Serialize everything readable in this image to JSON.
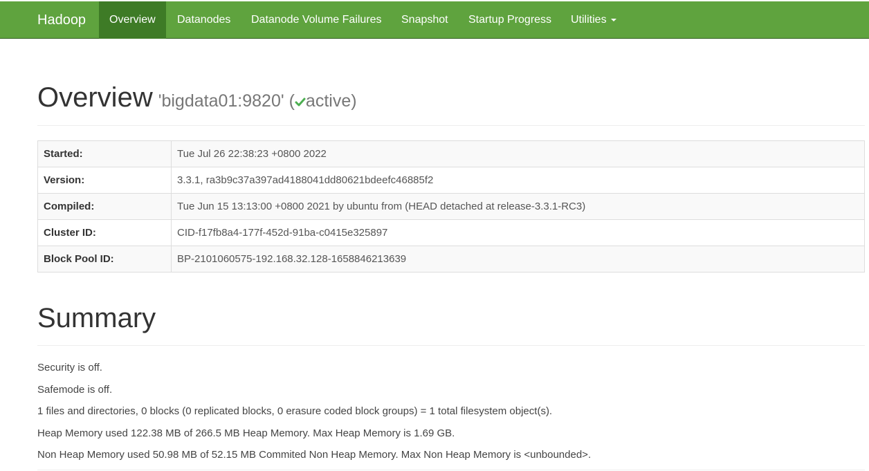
{
  "navbar": {
    "brand": "Hadoop",
    "items": [
      {
        "label": "Overview"
      },
      {
        "label": "Datanodes"
      },
      {
        "label": "Datanode Volume Failures"
      },
      {
        "label": "Snapshot"
      },
      {
        "label": "Startup Progress"
      },
      {
        "label": "Utilities"
      }
    ],
    "active_index": 0,
    "colors": {
      "bar": "#5fa33e",
      "active": "#3e7b26",
      "text": "#ffffff"
    }
  },
  "overview": {
    "title": "Overview",
    "host": "'bigdata01:9820'",
    "status_open": "(",
    "status": "active",
    "status_close": ")",
    "status_icon": "check-icon",
    "status_color": "#4caf50",
    "rows": [
      {
        "label": "Started:",
        "value": "Tue Jul 26 22:38:23 +0800 2022"
      },
      {
        "label": "Version:",
        "value": "3.3.1, ra3b9c37a397ad4188041dd80621bdeefc46885f2"
      },
      {
        "label": "Compiled:",
        "value": "Tue Jun 15 13:13:00 +0800 2021 by ubuntu from (HEAD detached at release-3.3.1-RC3)"
      },
      {
        "label": "Cluster ID:",
        "value": "CID-f17fb8a4-177f-452d-91ba-c0415e325897"
      },
      {
        "label": "Block Pool ID:",
        "value": "BP-2101060575-192.168.32.128-1658846213639"
      }
    ]
  },
  "summary": {
    "title": "Summary",
    "lines": [
      "Security is off.",
      "Safemode is off.",
      "1 files and directories, 0 blocks (0 replicated blocks, 0 erasure coded block groups) = 1 total filesystem object(s).",
      "Heap Memory used 122.38 MB of 266.5 MB Heap Memory. Max Heap Memory is 1.69 GB.",
      "Non Heap Memory used 50.98 MB of 52.15 MB Commited Non Heap Memory. Max Non Heap Memory is <unbounded>."
    ]
  }
}
